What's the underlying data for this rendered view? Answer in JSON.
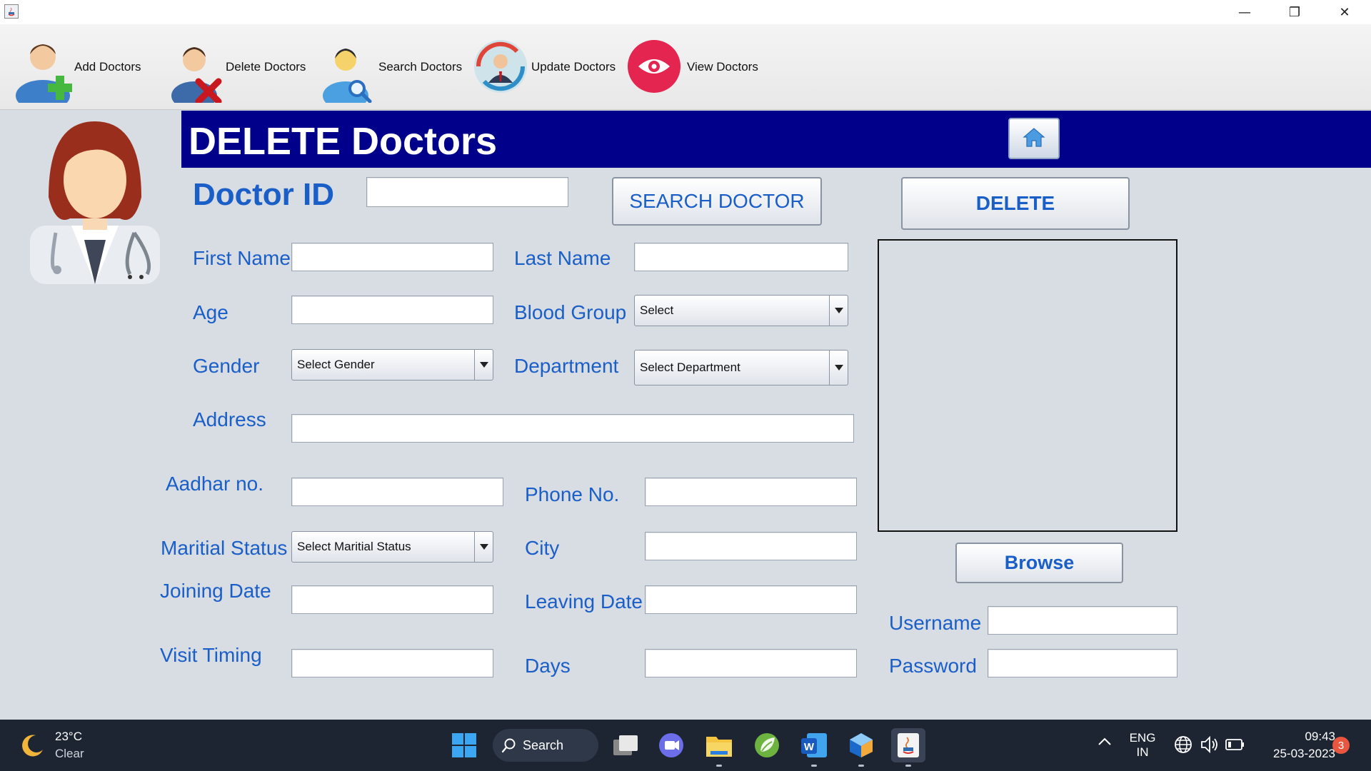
{
  "window": {
    "controls": {
      "minimize": "—",
      "maximize": "❐",
      "close": "✕"
    }
  },
  "toolbar": {
    "items": [
      {
        "label": "Add Doctors",
        "icon": "add-doctor-icon"
      },
      {
        "label": "Delete Doctors",
        "icon": "delete-doctor-icon"
      },
      {
        "label": "Search Doctors",
        "icon": "search-doctor-icon"
      },
      {
        "label": "Update Doctors",
        "icon": "update-doctor-icon"
      },
      {
        "label": "View Doctors",
        "icon": "eye-icon"
      }
    ]
  },
  "header": {
    "title": "DELETE Doctors",
    "home_icon": "home-icon"
  },
  "form": {
    "doctor_id": {
      "label": "Doctor ID",
      "value": ""
    },
    "search_button": "SEARCH DOCTOR",
    "delete_button": "DELETE",
    "first_name": {
      "label": "First Name",
      "value": ""
    },
    "last_name": {
      "label": "Last Name",
      "value": ""
    },
    "age": {
      "label": "Age",
      "value": ""
    },
    "blood_group": {
      "label": "Blood Group",
      "selected": "Select"
    },
    "gender": {
      "label": "Gender",
      "selected": "Select Gender"
    },
    "department": {
      "label": "Department",
      "selected": "Select Department"
    },
    "address": {
      "label": "Address",
      "value": ""
    },
    "aadhar": {
      "label": "Aadhar no.",
      "value": ""
    },
    "phone": {
      "label": "Phone No.",
      "value": ""
    },
    "marital_status": {
      "label": "Maritial Status",
      "selected": "Select Maritial Status"
    },
    "city": {
      "label": "City",
      "value": ""
    },
    "joining_date": {
      "label": "Joining Date",
      "value": ""
    },
    "leaving_date": {
      "label": "Leaving Date",
      "value": ""
    },
    "visit_timing": {
      "label": "Visit Timing",
      "value": ""
    },
    "days": {
      "label": "Days",
      "value": ""
    },
    "browse_button": "Browse",
    "username": {
      "label": "Username",
      "value": ""
    },
    "password": {
      "label": "Password",
      "value": ""
    }
  },
  "colors": {
    "header_bg": "#00008b",
    "label_blue": "#1a5fc8",
    "page_bg": "#d8dce3",
    "taskbar_bg": "#1d2533"
  },
  "taskbar": {
    "weather": {
      "temp": "23°C",
      "condition": "Clear",
      "icon": "moon-icon"
    },
    "search_label": "Search",
    "apps": [
      "windows-start-icon",
      "search-icon",
      "task-view-icon",
      "teams-chat-icon",
      "file-explorer-icon",
      "spring-tools-icon",
      "word-icon",
      "netbeans-icon",
      "java-icon"
    ],
    "language": {
      "line1": "ENG",
      "line2": "IN"
    },
    "time": "09:43",
    "date": "25-03-2023",
    "notification_count": "3"
  }
}
